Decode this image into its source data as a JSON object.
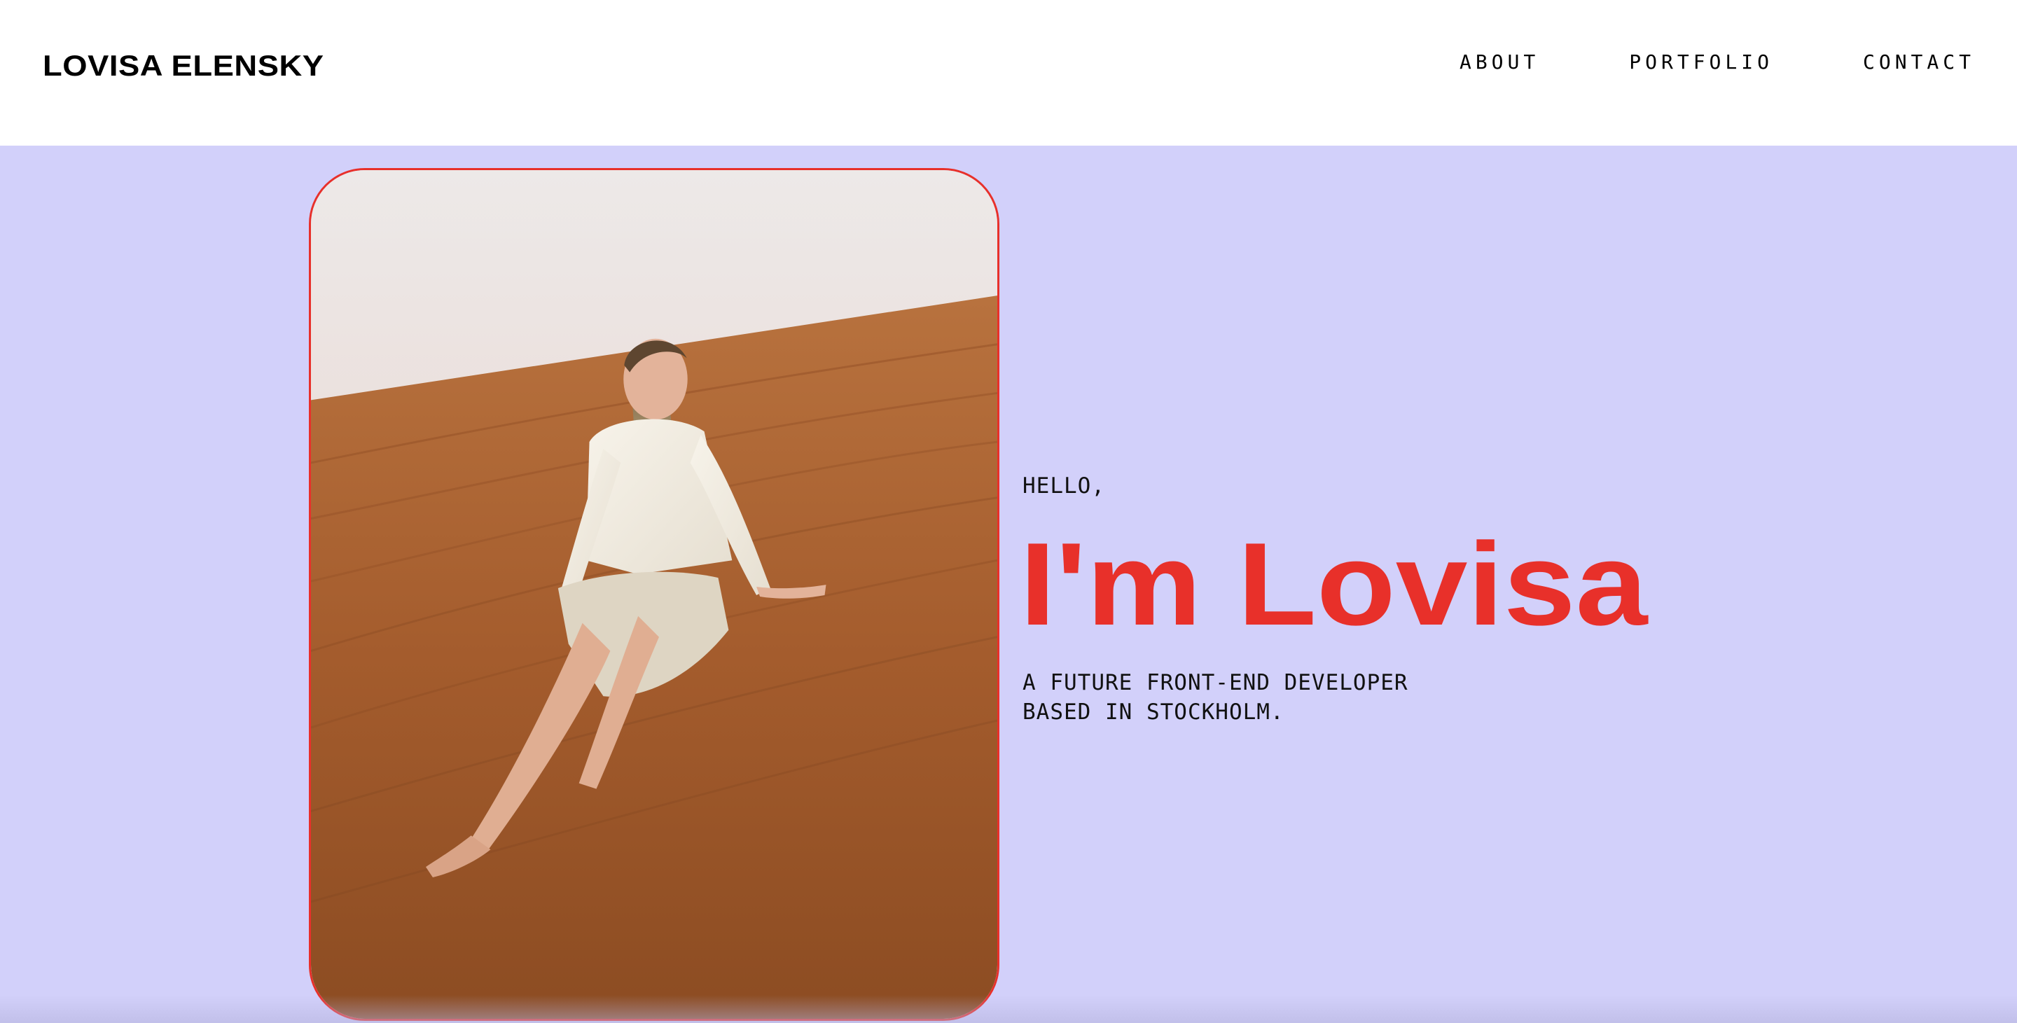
{
  "brand": {
    "name": "LOVISA ELENSKY"
  },
  "nav": {
    "items": [
      {
        "label": "ABOUT"
      },
      {
        "label": "PORTFOLIO"
      },
      {
        "label": "CONTACT"
      }
    ]
  },
  "hero": {
    "greeting": "HELLO,",
    "headline": "I'm Lovisa",
    "tagline_line1": "A FUTURE FRONT-END DEVELOPER",
    "tagline_line2": "BASED IN STOCKHOLM.",
    "photo_alt": "Woman in white sitting on a desert sand dune"
  },
  "colors": {
    "hero_background": "#d2d0fa",
    "accent": "#e8302a",
    "text": "#000000",
    "header_background": "#ffffff"
  }
}
